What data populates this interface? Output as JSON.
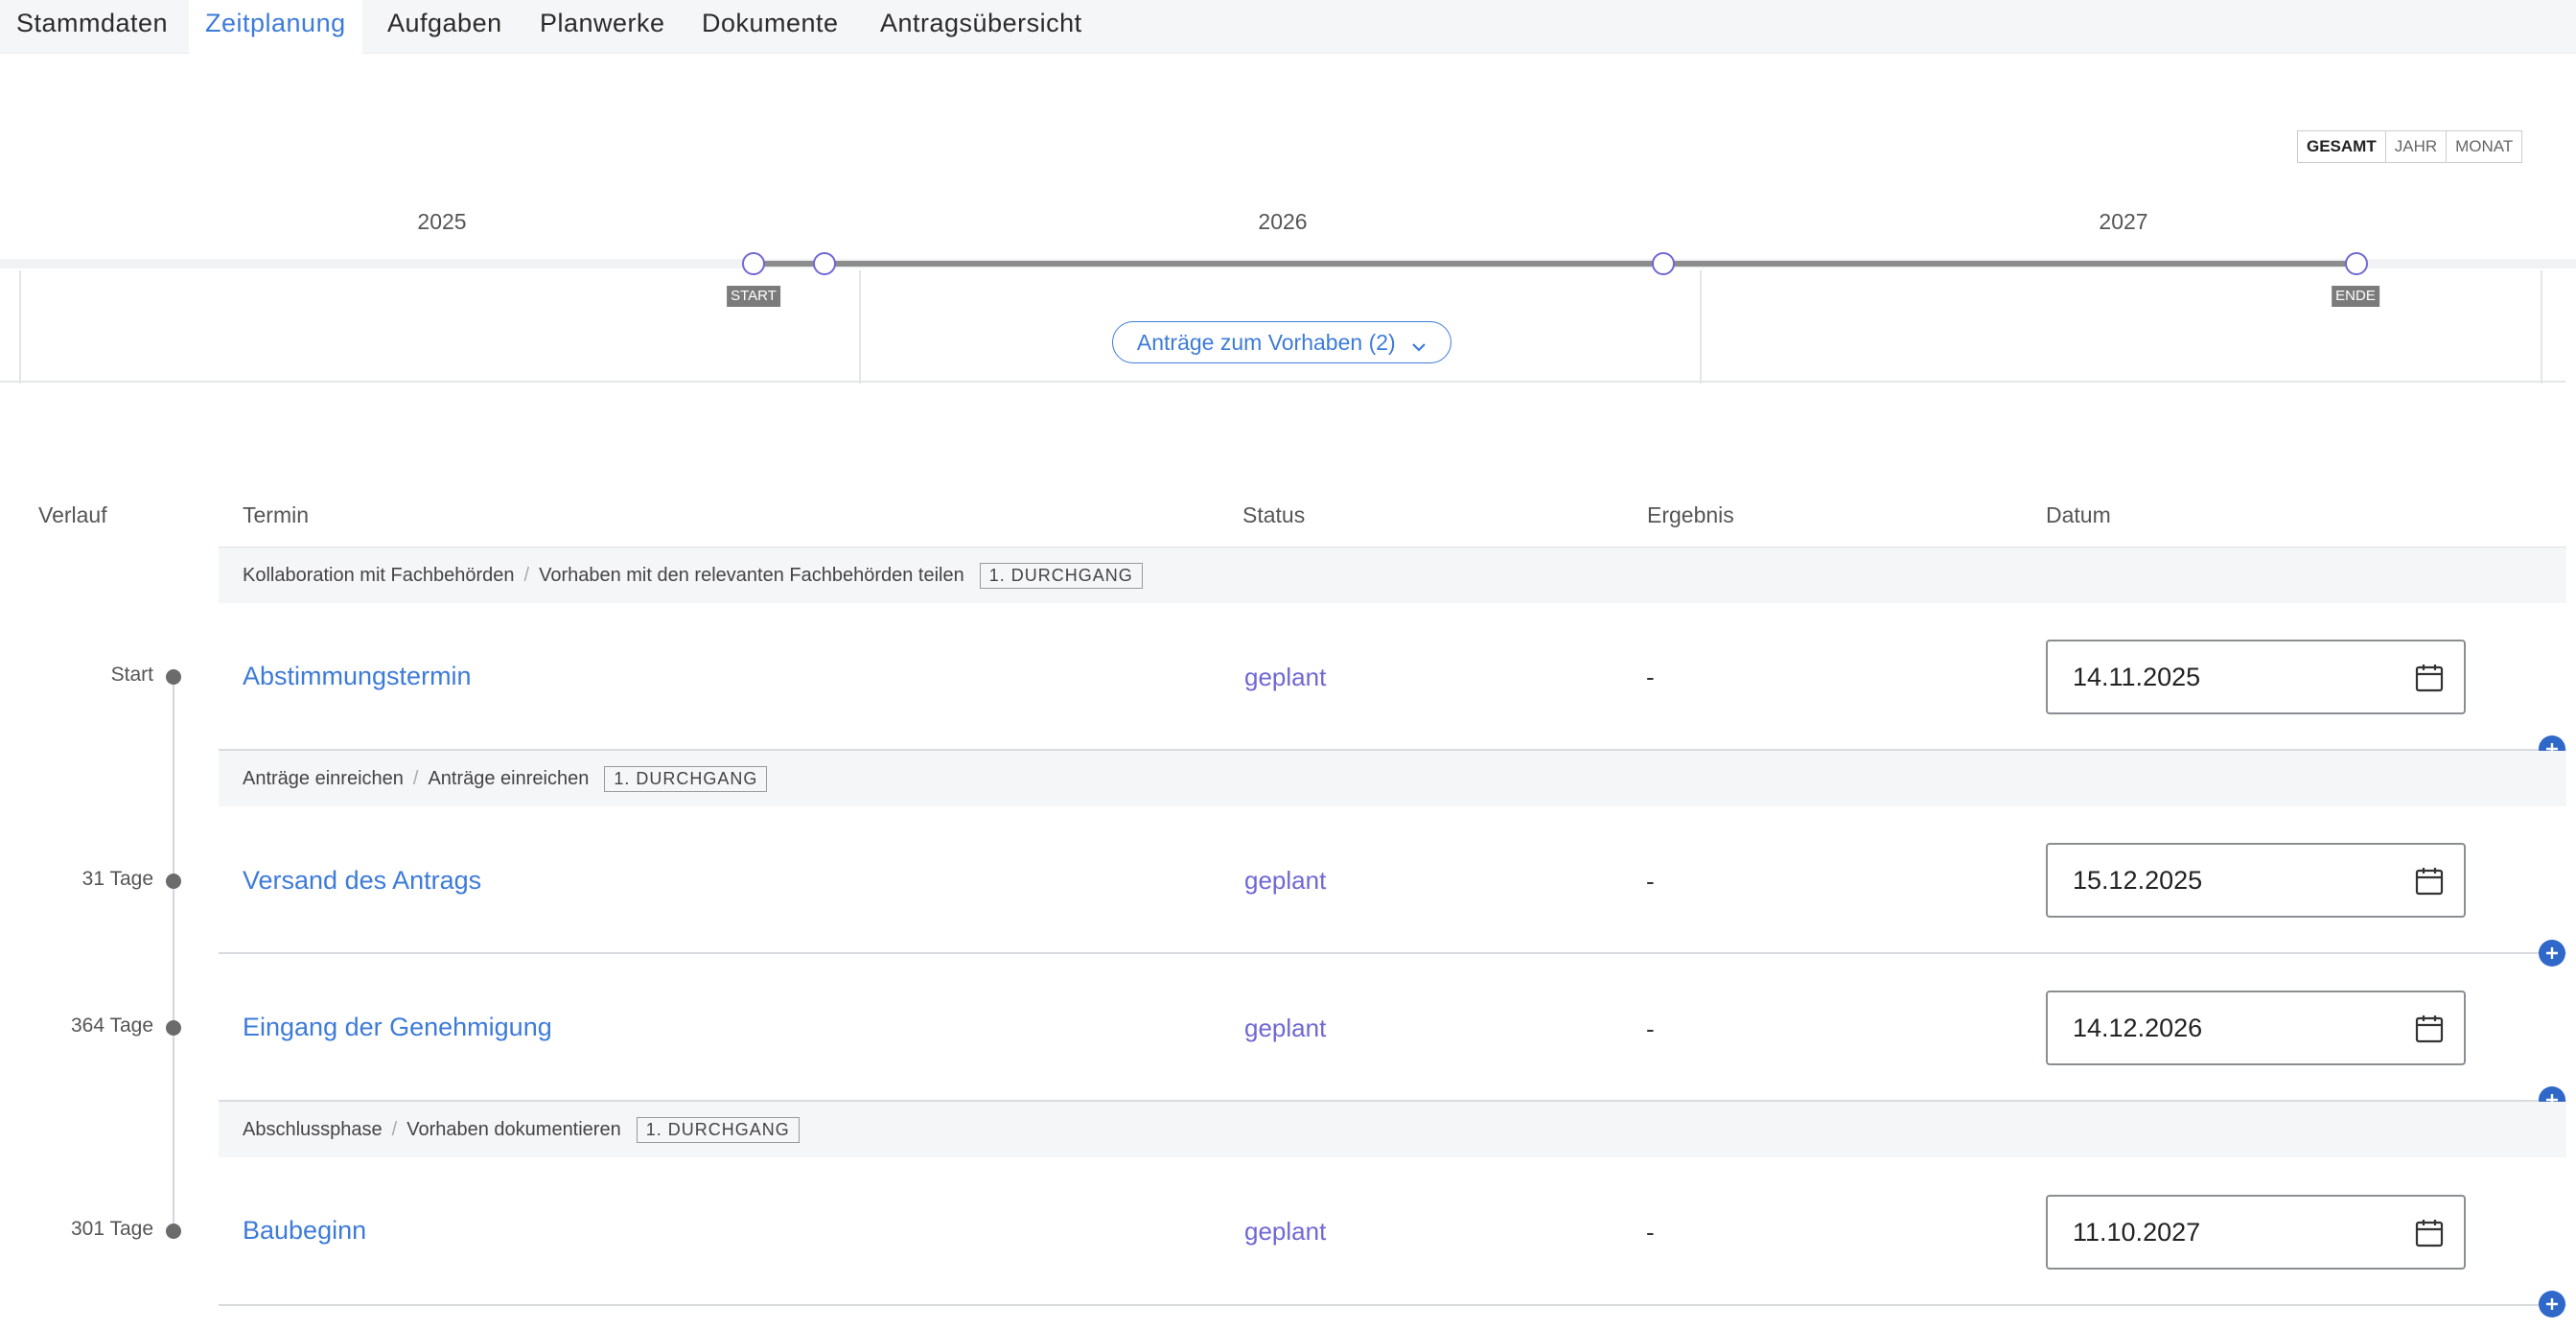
{
  "tabs": [
    {
      "label": "Stammdaten",
      "active": false
    },
    {
      "label": "Zeitplanung",
      "active": true
    },
    {
      "label": "Aufgaben",
      "active": false
    },
    {
      "label": "Planwerke",
      "active": false
    },
    {
      "label": "Dokumente",
      "active": false
    },
    {
      "label": "Antragsübersicht",
      "active": false
    }
  ],
  "view_toggle": {
    "options": [
      "GESAMT",
      "JAHR",
      "MONAT"
    ],
    "selected": "GESAMT"
  },
  "timeline": {
    "years": [
      "2025",
      "2026",
      "2027"
    ],
    "start_tag": "START",
    "end_tag": "ENDE",
    "antraege_button": "Anträge zum Vorhaben (2)"
  },
  "table": {
    "headers": {
      "verlauf": "Verlauf",
      "termin": "Termin",
      "status": "Status",
      "ergebnis": "Ergebnis",
      "datum": "Datum"
    },
    "groups": [
      {
        "phase": "Kollaboration mit Fachbehörden",
        "step": "Vorhaben mit den relevanten Fachbehörden teilen",
        "badge": "1. DURCHGANG"
      },
      {
        "phase": "Anträge einreichen",
        "step": "Anträge einreichen",
        "badge": "1. DURCHGANG"
      },
      {
        "phase": "Abschlussphase",
        "step": "Vorhaben dokumentieren",
        "badge": "1. DURCHGANG"
      }
    ],
    "rows": [
      {
        "verlauf": "Start",
        "termin": "Abstimmungstermin",
        "status": "geplant",
        "ergebnis": "-",
        "datum": "14.11.2025"
      },
      {
        "verlauf": "31 Tage",
        "termin": "Versand des Antrags",
        "status": "geplant",
        "ergebnis": "-",
        "datum": "15.12.2025"
      },
      {
        "verlauf": "364 Tage",
        "termin": "Eingang der Genehmigung",
        "status": "geplant",
        "ergebnis": "-",
        "datum": "14.12.2026"
      },
      {
        "verlauf": "301 Tage",
        "termin": "Baubeginn",
        "status": "geplant",
        "ergebnis": "-",
        "datum": "11.10.2027"
      }
    ]
  },
  "colors": {
    "accent": "#3d7bd9",
    "status": "#6f67d5",
    "add_button": "#3068c9",
    "timeline_bar": "#8c8c8c"
  },
  "icons": {
    "calendar": "calendar-icon",
    "chevron": "chevron-down-icon",
    "add": "plus-circle-icon"
  }
}
